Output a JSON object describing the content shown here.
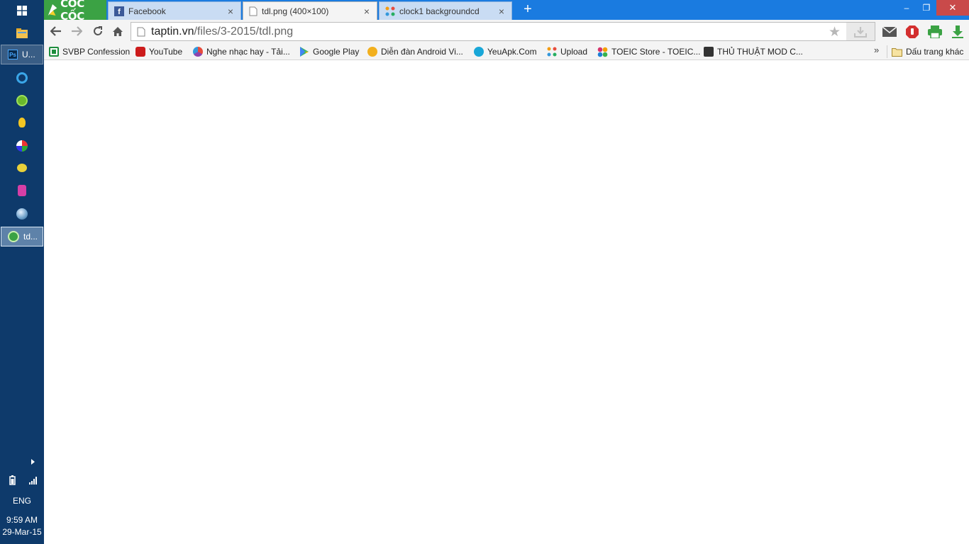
{
  "taskbar": {
    "items": [
      {
        "label": "U...",
        "icon": "photoshop-icon"
      },
      {
        "label": "",
        "icon": "coccoc-browser-icon"
      },
      {
        "label": "",
        "icon": "utorrent-icon"
      },
      {
        "label": "",
        "icon": "yellow-app-icon"
      },
      {
        "label": "",
        "icon": "media-player-icon"
      },
      {
        "label": "",
        "icon": "bird-icon"
      },
      {
        "label": "",
        "icon": "pink-app-icon"
      },
      {
        "label": "",
        "icon": "globe-icon"
      },
      {
        "label": "td...",
        "icon": "coccoc-window-icon"
      }
    ],
    "tray": {
      "language": "ENG",
      "time": "9:59 AM",
      "date": "29-Mar-15"
    }
  },
  "browser": {
    "logo_text": "CỐC CỐC",
    "tabs": [
      {
        "title": "Facebook",
        "icon": "facebook-icon"
      },
      {
        "title": "tdl.png (400×100)",
        "icon": "page-icon"
      },
      {
        "title": "clock1 backgroundcd",
        "icon": "joomla-icon"
      }
    ],
    "close_glyph": "×",
    "new_tab_glyph": "+",
    "window": {
      "minimize": "–",
      "maximize": "❐",
      "close": "✕"
    },
    "address": {
      "host": "taptin.vn",
      "path": "/files/3-2015/tdl.png"
    },
    "bookmarks": [
      {
        "label": "SVBP Confession",
        "icon": "spreadsheet-icon",
        "color": "#1e8e3e"
      },
      {
        "label": "YouTube",
        "icon": "youtube-icon",
        "color": "#cc1b1b"
      },
      {
        "label": "Nghe nhạc hay - Tải...",
        "icon": "music-icon",
        "color": "#8e44ad"
      },
      {
        "label": "Google Play",
        "icon": "google-play-icon",
        "color": "#3bb36b"
      },
      {
        "label": "Diễn đàn Android Vi...",
        "icon": "smiley-icon",
        "color": "#f2b01e"
      },
      {
        "label": "YeuApk.Com",
        "icon": "yeuapk-icon",
        "color": "#19a7d8"
      },
      {
        "label": "Upload",
        "icon": "joomla-icon",
        "color": "#e35a2a"
      },
      {
        "label": "TOEIC Store - TOEIC...",
        "icon": "toeic-icon",
        "color": "#d6336c"
      },
      {
        "label": "THỦ THUẬT MOD C...",
        "icon": "mod-icon",
        "color": "#333333"
      }
    ],
    "bookmarks_more": "»",
    "other_bookmarks": "Dấu trang khác"
  },
  "colors": {
    "taskbar": "#0e3a6b",
    "tabstrip": "#1a7be0",
    "logo": "#3ba244",
    "toolbar": "#f4f4f4"
  }
}
